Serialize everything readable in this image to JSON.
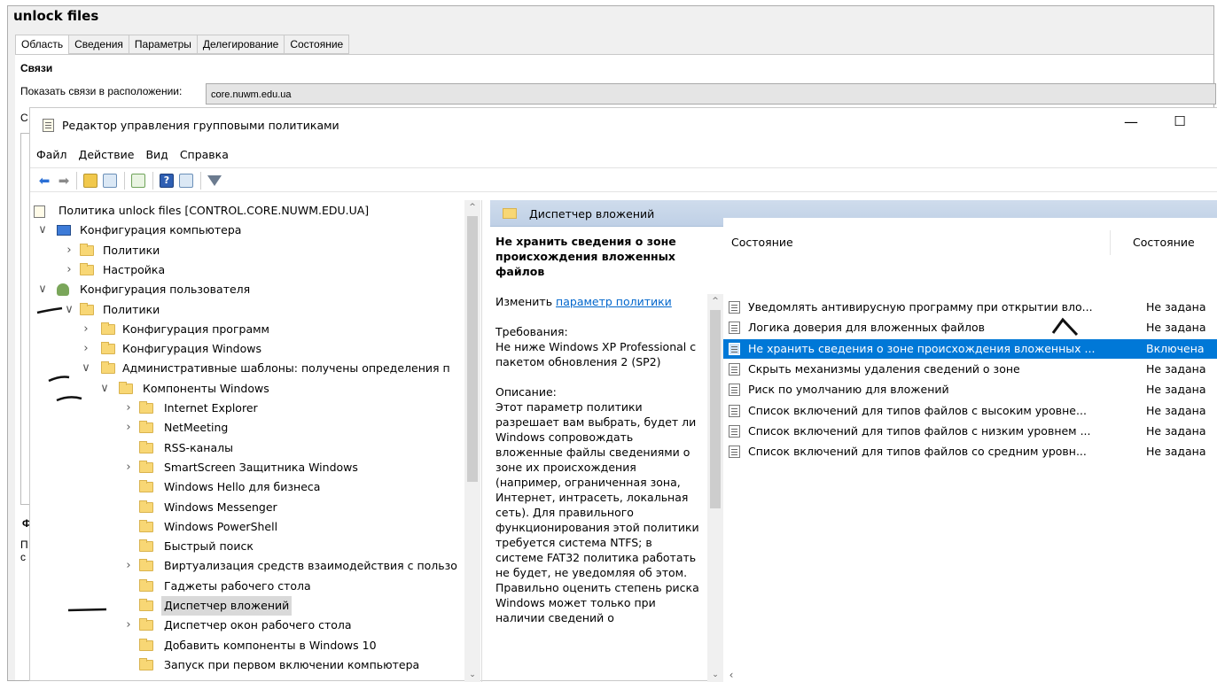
{
  "background_window": {
    "title": "unlock files",
    "tabs": [
      "Область",
      "Сведения",
      "Параметры",
      "Делегирование",
      "Состояние"
    ],
    "section_title": "Связи",
    "show_links_label": "Показать связи в расположении:",
    "location_value": "core.nuwm.edu.ua",
    "left_fragments": [
      "С",
      "Ф",
      "П",
      "с"
    ]
  },
  "editor": {
    "title": "Редактор управления групповыми политиками",
    "minimize": "—",
    "maximize": "☐",
    "menu": [
      "Файл",
      "Действие",
      "Вид",
      "Справка"
    ],
    "tree": [
      {
        "label": "Политика unlock files [CONTROL.CORE.NUWM.EDU.UA]",
        "level": 0,
        "chev": "",
        "icon": "policy"
      },
      {
        "label": "Конфигурация компьютера",
        "level": 0,
        "chev": "v",
        "icon": "computer"
      },
      {
        "label": "Политики",
        "level": 1,
        "chev": ">",
        "icon": "folder"
      },
      {
        "label": "Настройка",
        "level": 1,
        "chev": ">",
        "icon": "folder"
      },
      {
        "label": "Конфигурация пользователя",
        "level": 0,
        "chev": "v",
        "icon": "user"
      },
      {
        "label": "Политики",
        "level": 1,
        "chev": "v",
        "icon": "folder"
      },
      {
        "label": "Конфигурация программ",
        "level": 2,
        "chev": ">",
        "icon": "folder"
      },
      {
        "label": "Конфигурация Windows",
        "level": 2,
        "chev": ">",
        "icon": "folder"
      },
      {
        "label": "Административные шаблоны: получены определения п",
        "level": 2,
        "chev": "v",
        "icon": "folder"
      },
      {
        "label": "Компоненты Windows",
        "level": 3,
        "chev": "v",
        "icon": "folder"
      },
      {
        "label": "Internet Explorer",
        "level": 4,
        "chev": ">",
        "icon": "folder"
      },
      {
        "label": "NetMeeting",
        "level": 4,
        "chev": ">",
        "icon": "folder"
      },
      {
        "label": "RSS-каналы",
        "level": 4,
        "chev": "",
        "icon": "folder"
      },
      {
        "label": "SmartScreen Защитника Windows",
        "level": 4,
        "chev": ">",
        "icon": "folder"
      },
      {
        "label": "Windows Hello для бизнеса",
        "level": 4,
        "chev": "",
        "icon": "folder"
      },
      {
        "label": "Windows Messenger",
        "level": 4,
        "chev": "",
        "icon": "folder"
      },
      {
        "label": "Windows PowerShell",
        "level": 4,
        "chev": "",
        "icon": "folder"
      },
      {
        "label": "Быстрый поиск",
        "level": 4,
        "chev": "",
        "icon": "folder"
      },
      {
        "label": "Виртуализация средств взаимодействия с пользо",
        "level": 4,
        "chev": ">",
        "icon": "folder"
      },
      {
        "label": "Гаджеты рабочего стола",
        "level": 4,
        "chev": "",
        "icon": "folder"
      },
      {
        "label": "Диспетчер вложений",
        "level": 4,
        "chev": "",
        "icon": "folder",
        "selected": true
      },
      {
        "label": "Диспетчер окон рабочего стола",
        "level": 4,
        "chev": ">",
        "icon": "folder"
      },
      {
        "label": "Добавить компоненты в Windows 10",
        "level": 4,
        "chev": "",
        "icon": "folder"
      },
      {
        "label": "Запуск при первом включении компьютера",
        "level": 4,
        "chev": "",
        "icon": "folder"
      }
    ],
    "right_header": "Диспетчер вложений",
    "description": {
      "title": "Не хранить сведения о зоне происхождения вложенных файлов",
      "edit_prefix": "Изменить ",
      "edit_link": "параметр политики",
      "requirements": "Требования:\nНе ниже Windows XP Professional с пакетом обновления 2 (SP2)",
      "description": "Описание:\nЭтот параметр политики разрешает вам выбрать, будет ли Windows сопровождать вложенные файлы сведениями о зоне их происхождения (например, ограниченная зона, Интернет, интрасеть, локальная сеть). Для правильного функционирования этой политики требуется система NTFS; в системе FAT32 политика работать не будет, не уведомляя об этом. Правильно оценить степень риска Windows может только при наличии сведений о"
    },
    "list_columns": {
      "name": "Состояние",
      "state": "Состояние"
    },
    "settings": [
      {
        "name": "Уведомлять антивирусную программу при открытии вло...",
        "state": "Не задана"
      },
      {
        "name": "Логика доверия для вложенных файлов",
        "state": "Не задана"
      },
      {
        "name": "Не хранить сведения о зоне происхождения вложенных ...",
        "state": "Включена",
        "selected": true
      },
      {
        "name": "Скрыть механизмы удаления сведений о зоне",
        "state": "Не задана"
      },
      {
        "name": "Риск по умолчанию для вложений",
        "state": "Не задана"
      },
      {
        "name": "Список включений для типов файлов с высоким уровне...",
        "state": "Не задана"
      },
      {
        "name": "Список включений для типов файлов с низким уровнем ...",
        "state": "Не задана"
      },
      {
        "name": "Список включений для типов файлов со средним уровн...",
        "state": "Не задана"
      }
    ],
    "colors": {
      "selection": "#0078d7",
      "header": "#c6d6ea",
      "folder": "#f8d775"
    }
  }
}
